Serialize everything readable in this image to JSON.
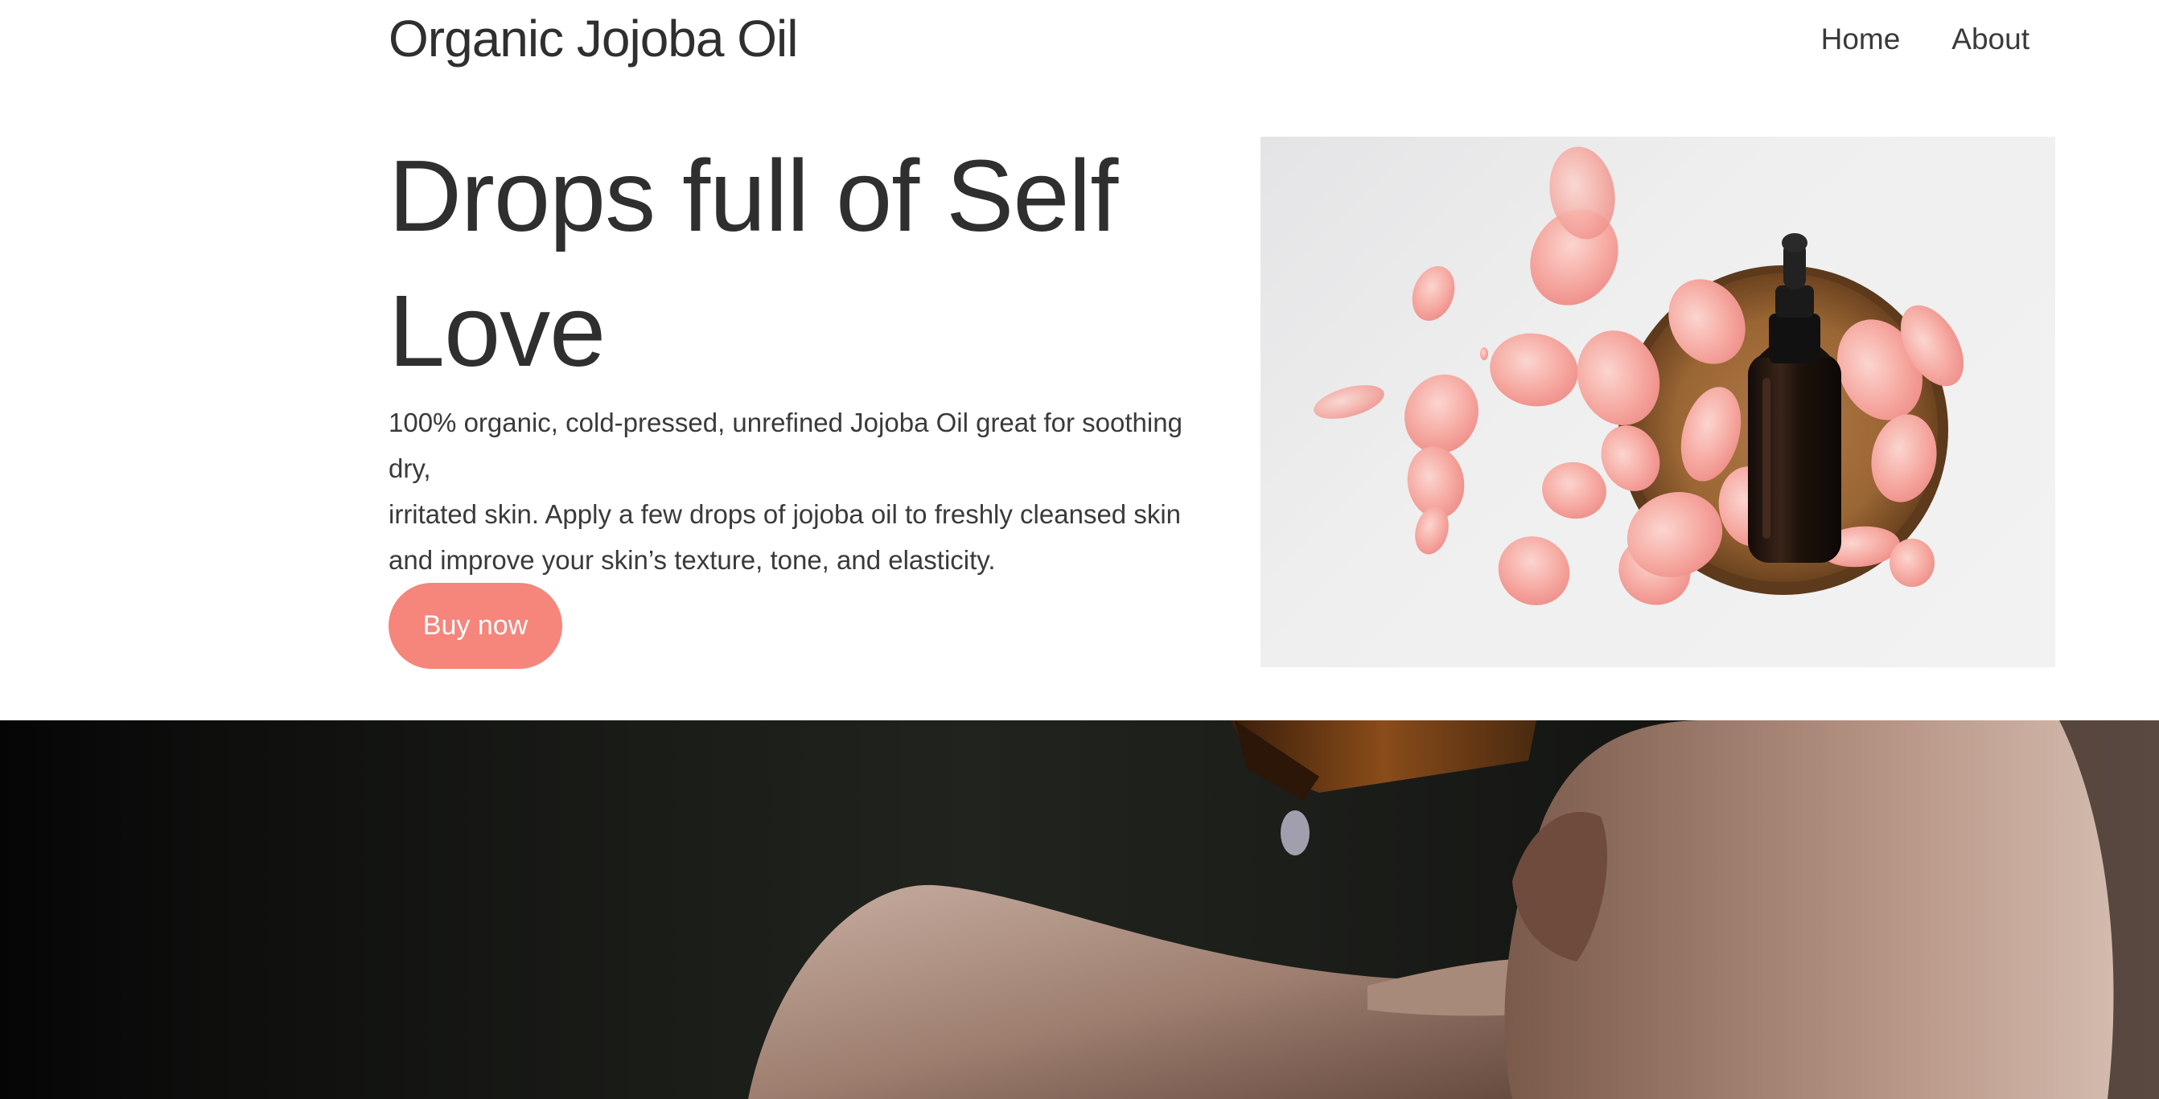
{
  "header": {
    "site_title": "Organic Jojoba Oil",
    "nav": [
      {
        "label": "Home"
      },
      {
        "label": "About"
      }
    ]
  },
  "hero": {
    "heading_line1": "Drops full of Self",
    "heading_line2": "Love",
    "body_line1": "100% organic, cold-pressed, unrefined Jojoba Oil great for soothing dry,",
    "body_line2": "irritated skin. Apply a few drops of jojoba oil to freshly cleansed skin",
    "body_line3": "and improve your skin’s texture, tone, and elasticity.",
    "cta_label": "Buy now"
  },
  "colors": {
    "accent": "#f6857b",
    "text": "#2f2f2f",
    "background": "#ffffff"
  },
  "images": {
    "product": "dropper-bottle-with-rose-petals-on-wooden-plate",
    "banner": "oil-dropping-onto-hands"
  }
}
